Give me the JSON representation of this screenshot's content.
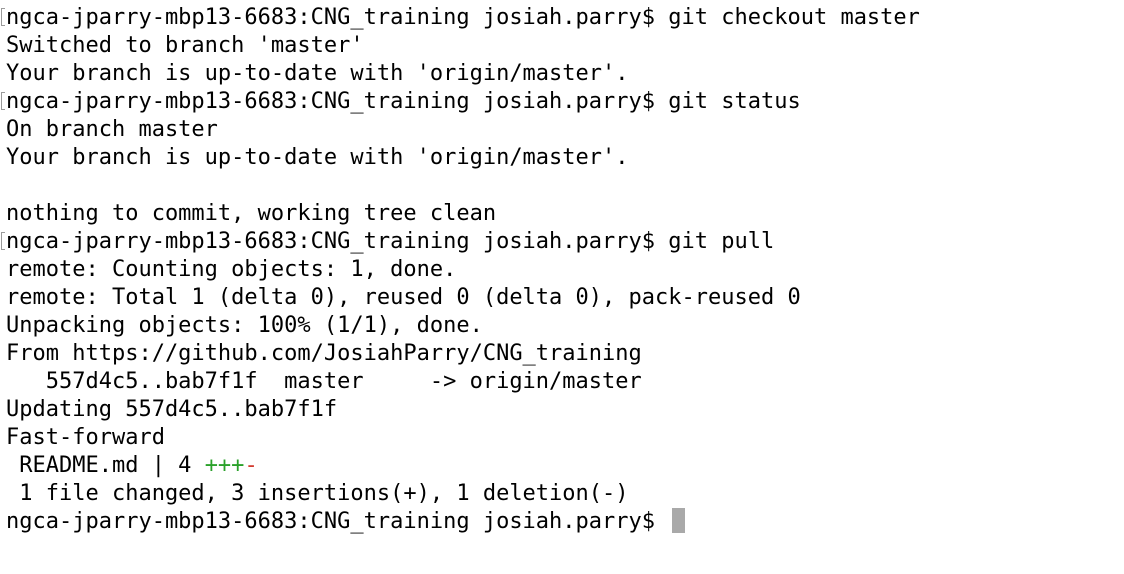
{
  "terminal": {
    "lines": [
      {
        "kind": "prompt",
        "text": "ngca-jparry-mbp13-6683:CNG_training josiah.parry$ git checkout master"
      },
      {
        "kind": "output",
        "text": "Switched to branch 'master'"
      },
      {
        "kind": "output",
        "text": "Your branch is up-to-date with 'origin/master'."
      },
      {
        "kind": "prompt",
        "text": "ngca-jparry-mbp13-6683:CNG_training josiah.parry$ git status"
      },
      {
        "kind": "output",
        "text": "On branch master"
      },
      {
        "kind": "output",
        "text": "Your branch is up-to-date with 'origin/master'."
      },
      {
        "kind": "blank",
        "text": ""
      },
      {
        "kind": "output",
        "text": "nothing to commit, working tree clean"
      },
      {
        "kind": "prompt",
        "text": "ngca-jparry-mbp13-6683:CNG_training josiah.parry$ git pull"
      },
      {
        "kind": "output",
        "text": "remote: Counting objects: 1, done."
      },
      {
        "kind": "output",
        "text": "remote: Total 1 (delta 0), reused 0 (delta 0), pack-reused 0"
      },
      {
        "kind": "output",
        "text": "Unpacking objects: 100% (1/1), done."
      },
      {
        "kind": "output",
        "text": "From https://github.com/JosiahParry/CNG_training"
      },
      {
        "kind": "output",
        "text": "   557d4c5..bab7f1f  master     -> origin/master"
      },
      {
        "kind": "output",
        "text": "Updating 557d4c5..bab7f1f"
      },
      {
        "kind": "output",
        "text": "Fast-forward"
      }
    ],
    "diffstat": {
      "prefix": " README.md | 4 ",
      "additions": "+++",
      "deletions": "-"
    },
    "summary": " 1 file changed, 3 insertions(+), 1 deletion(-)",
    "current_prompt": "ngca-jparry-mbp13-6683:CNG_training josiah.parry$ ",
    "colors": {
      "additions": "#2aa12a",
      "deletions": "#d33b2f",
      "cursor": "#a9a9a9"
    }
  }
}
